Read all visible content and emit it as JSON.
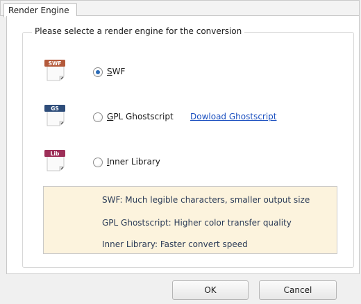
{
  "tab": {
    "label": "Render Engine"
  },
  "group": {
    "caption": "Please selecte a render engine for the conversion"
  },
  "engines": [
    {
      "icon_text": "SWF",
      "icon_color": "#b45a3b",
      "label_mnemonic": "S",
      "label_rest": "WF",
      "selected": true,
      "link": ""
    },
    {
      "icon_text": "GS",
      "icon_color": "#2e4d7a",
      "label_mnemonic": "G",
      "label_rest": "PL Ghostscript",
      "selected": false,
      "link": "Dowload Ghostscript"
    },
    {
      "icon_text": "Lib",
      "icon_color": "#9d2f58",
      "label_mnemonic": "I",
      "label_rest": "nner Library",
      "selected": false,
      "link": ""
    }
  ],
  "info": [
    "SWF: Much legible characters, smaller output size",
    "GPL Ghostscript: Higher color transfer quality",
    "Inner Library: Faster convert speed"
  ],
  "buttons": {
    "ok": "OK",
    "cancel": "Cancel"
  },
  "colors": {
    "info_bg": "#fcf3dd",
    "link": "#1a4fbf",
    "radio_dot": "#2a6bb7"
  }
}
